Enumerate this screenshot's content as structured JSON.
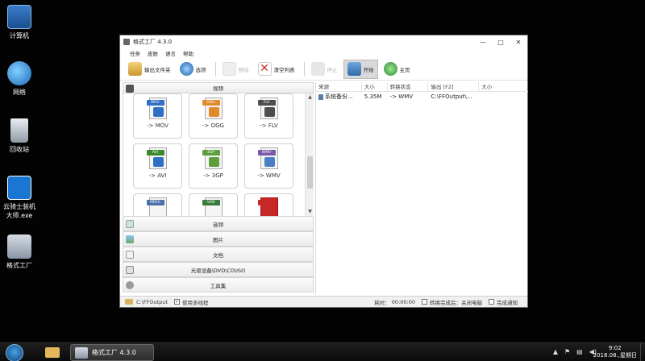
{
  "desktop": {
    "icons": [
      {
        "label": "计算机"
      },
      {
        "label": "网络"
      },
      {
        "label": "回收站"
      },
      {
        "label": "云骑士装机\n大师.exe"
      },
      {
        "label": "格式工厂"
      }
    ]
  },
  "window": {
    "title": "格式工厂 4.3.0",
    "controls": {
      "minimize": "—",
      "maximize": "□",
      "close": "✕"
    },
    "menu": [
      "任务",
      "皮肤",
      "语言",
      "帮助"
    ],
    "toolbar": {
      "output_folder": "输出文件夹",
      "options": "选项",
      "remove": "移除",
      "clear_list": "清空列表",
      "stop": "停止",
      "start": "开始",
      "home": "主页"
    },
    "left": {
      "video_header": "视频",
      "formats": [
        {
          "tag": "MOV",
          "label": "-> MOV",
          "color": "#2f6fc4"
        },
        {
          "tag": "OGG",
          "label": "-> OGG",
          "color": "#e08a2c"
        },
        {
          "tag": "FLV",
          "label": "-> FLV",
          "color": "#4d4d4d"
        },
        {
          "tag": "AVI",
          "label": "-> AVI",
          "color": "#3c8a2e"
        },
        {
          "tag": "3GP",
          "label": "-> 3GP",
          "color": "#5b9e3a"
        },
        {
          "tag": "WMV",
          "label": "-> WMV",
          "color": "#7a5aa8"
        },
        {
          "tag": "MPEG",
          "label": "",
          "color": "#4a6fa8"
        },
        {
          "tag": "VOB",
          "label": "",
          "color": "#3a7a3a"
        },
        {
          "tag": "SWF",
          "label": "",
          "color": "#c62828"
        }
      ],
      "categories": [
        "音频",
        "图片",
        "文档",
        "光驱设备\\DVD\\CD\\ISO",
        "工具集"
      ]
    },
    "right": {
      "columns": [
        "来源",
        "大小",
        "转换状态",
        "输出 [F2]",
        "大小"
      ],
      "rows": [
        {
          "source": "系统备份...",
          "size": "5.35M",
          "status": "-> WMV",
          "output": "C:\\FFOutput\\...",
          "out_size": ""
        }
      ]
    },
    "status": {
      "output_path": "C:\\FFOutput",
      "multithread": "使用多线程",
      "multithread_checked": "✓",
      "elapsed_label": "耗时：",
      "elapsed": "00:00:00",
      "after_convert": "转换完成后：关闭电脑",
      "notify": "完成通知"
    }
  },
  "taskbar": {
    "app_label": "格式工厂 4.3.0",
    "time": "9:02",
    "date": "2018.08.,星期日"
  }
}
